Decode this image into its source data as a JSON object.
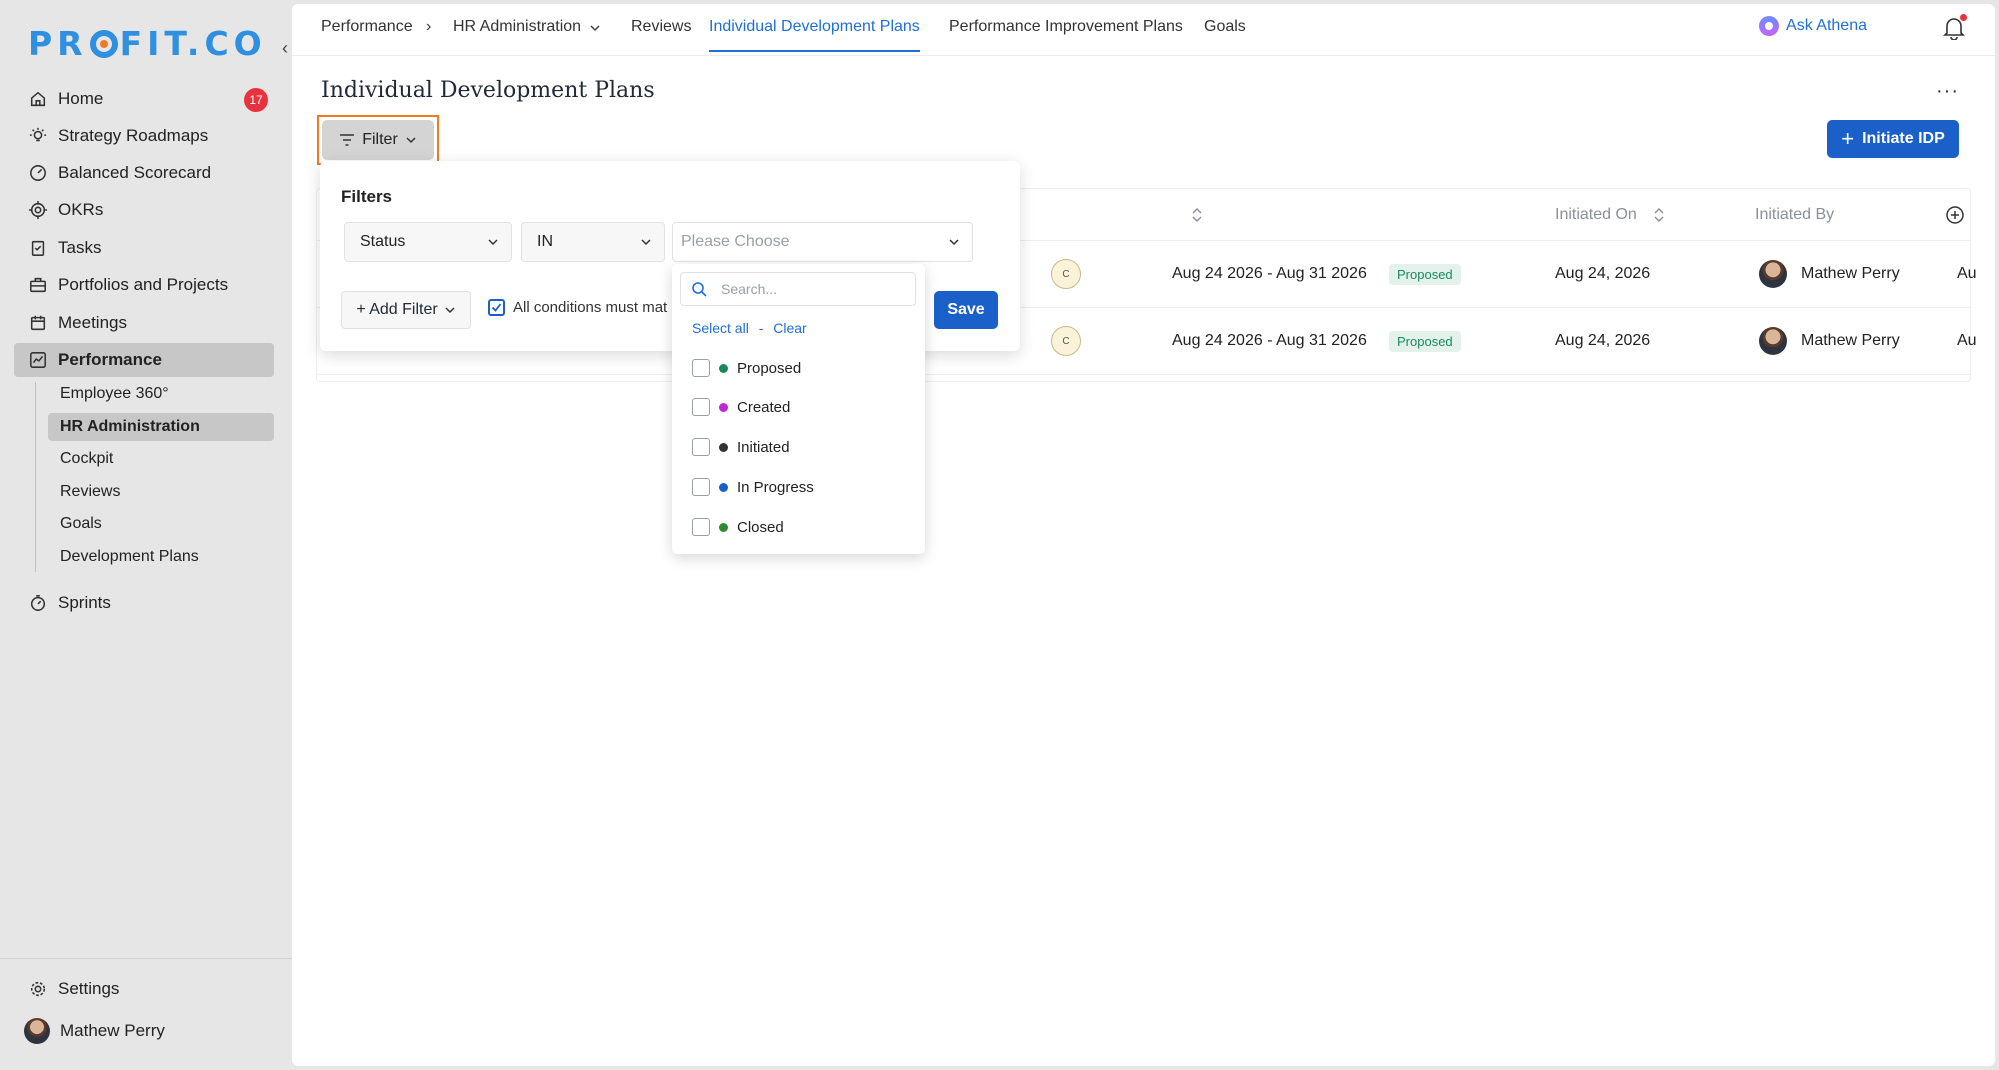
{
  "sidebar": {
    "logo": "PROFIT.CO",
    "logo_parts": [
      "PR",
      "FIT.CO"
    ],
    "home_badge": "17",
    "items": [
      {
        "label": "Home",
        "icon": "home-icon"
      },
      {
        "label": "Strategy Roadmaps",
        "icon": "lightbulb-icon"
      },
      {
        "label": "Balanced Scorecard",
        "icon": "gauge-icon"
      },
      {
        "label": "OKRs",
        "icon": "target-icon"
      },
      {
        "label": "Tasks",
        "icon": "clipboard-icon"
      },
      {
        "label": "Portfolios and Projects",
        "icon": "briefcase-icon"
      },
      {
        "label": "Meetings",
        "icon": "calendar-icon"
      },
      {
        "label": "Performance",
        "icon": "chart-icon"
      },
      {
        "label": "Sprints",
        "icon": "stopwatch-icon"
      }
    ],
    "sub_items": [
      {
        "label": "Employee 360°"
      },
      {
        "label": "HR Administration"
      },
      {
        "label": "Cockpit"
      },
      {
        "label": "Reviews"
      },
      {
        "label": "Goals"
      },
      {
        "label": "Development Plans"
      }
    ],
    "settings": "Settings",
    "user": "Mathew Perry"
  },
  "topnav": {
    "breadcrumb_root": "Performance",
    "breadcrumb_sep": "›",
    "hr_admin": "HR Administration",
    "tabs": [
      {
        "label": "Reviews"
      },
      {
        "label": "Individual Development Plans"
      },
      {
        "label": "Performance Improvement Plans"
      },
      {
        "label": "Goals"
      }
    ],
    "ask": "Ask Athena"
  },
  "page": {
    "title": "Individual Development Plans",
    "more": "···",
    "filter_label": "Filter",
    "initiate_label": "Initiate IDP"
  },
  "table": {
    "headers": {
      "initiated_on": "Initiated On",
      "initiated_by": "Initiated By"
    },
    "rows": [
      {
        "initial": "C",
        "period": "Aug 24 2026 - Aug 31 2026",
        "status": "Proposed",
        "initiated_on": "Aug 24, 2026",
        "initiated_by": "Mathew Perry",
        "extra": "Au"
      },
      {
        "initial": "C",
        "period": "Aug 24 2026 - Aug 31 2026",
        "status": "Proposed",
        "initiated_on": "Aug 24, 2026",
        "initiated_by": "Mathew Perry",
        "extra": "Au"
      }
    ]
  },
  "filter_panel": {
    "title": "Filters",
    "field": "Status",
    "operator": "IN",
    "value_placeholder": "Please Choose",
    "add_filter": "+ Add Filter",
    "all_conditions": "All conditions must mat",
    "save": "Save"
  },
  "dropdown": {
    "search_placeholder": "Search...",
    "select_all": "Select all",
    "dash": "-",
    "clear": "Clear",
    "options": [
      {
        "label": "Proposed",
        "color": "#1a8a5a"
      },
      {
        "label": "Created",
        "color": "#c026d3"
      },
      {
        "label": "Initiated",
        "color": "#333333"
      },
      {
        "label": "In Progress",
        "color": "#1b5fc9"
      },
      {
        "label": "Closed",
        "color": "#2e8b2e"
      }
    ]
  }
}
